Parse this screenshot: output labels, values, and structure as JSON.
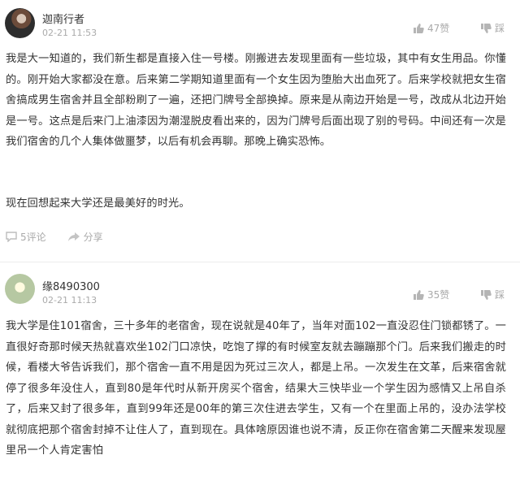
{
  "comments": [
    {
      "username": "迦南行者",
      "time": "02-21 11:53",
      "likes": "47赞",
      "dislike": "踩",
      "paragraphs": [
        "我是大一知道的，我们新生都是直接入住一号楼。刚搬进去发现里面有一些垃圾，其中有女生用品。你懂的。刚开始大家都没在意。后来第二学期知道里面有一个女生因为堕胎大出血死了。后来学校就把女生宿舍搞成男生宿舍并且全部粉刷了一遍，还把门牌号全部换掉。原来是从南边开始是一号，改成从北边开始是一号。这点是后来门上油漆因为潮湿脱皮看出来的，因为门牌号后面出现了别的号码。中间还有一次是我们宿舍的几个人集体做噩梦，以后有机会再聊。那晚上确实恐怖。",
        "现在回想起来大学还是最美好的时光。"
      ],
      "reply_label": "5评论",
      "share_label": "分享"
    },
    {
      "username": "缘8490300",
      "time": "02-21 11:13",
      "likes": "35赞",
      "dislike": "踩",
      "paragraphs": [
        "我大学是住101宿舍，三十多年的老宿舍，现在说就是40年了，当年对面102一直没忍住门锁都锈了。一直很好奇那时候天热就喜欢坐102门口凉快，吃饱了撑的有时候室友就去蹦蹦那个门。后来我们搬走的时候，看楼大爷告诉我们，那个宿舍一直不用是因为死过三次人，都是上吊。一次发生在文革，后来宿舍就停了很多年没住人，直到80是年代时从新开房买个宿舍，结果大三快毕业一个学生因为感情又上吊自杀了，后来又封了很多年，直到99年还是00年的第三次住进去学生，又有一个在里面上吊的，没办法学校就彻底把那个宿舍封掉不让住人了，直到现在。具体啥原因谁也说不清，反正你在宿舍第二天醒来发现屋里吊一个人肯定害怕"
      ]
    }
  ],
  "icons": {
    "like": "thumbs-up-icon",
    "dislike": "thumbs-down-icon",
    "comment": "comment-icon",
    "share": "share-icon"
  }
}
